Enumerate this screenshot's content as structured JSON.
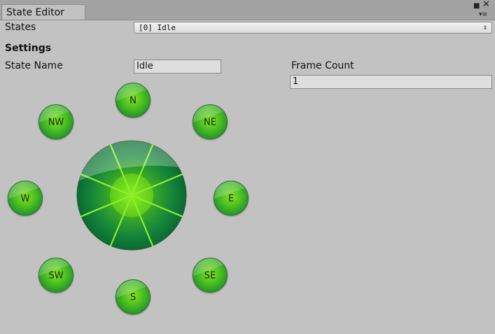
{
  "window": {
    "tab_title": "State Editor",
    "maximize_icon": "maximize-icon",
    "close_icon": "close-icon",
    "menu_icon": "menu-icon"
  },
  "states": {
    "label": "States",
    "selected": "[0] Idle"
  },
  "settings": {
    "heading": "Settings",
    "state_name_label": "State Name",
    "state_name_value": "Idle",
    "frame_count_label": "Frame Count",
    "frame_count_value": "1"
  },
  "directions": {
    "n": "N",
    "ne": "NE",
    "e": "E",
    "se": "SE",
    "s": "S",
    "sw": "SW",
    "w": "W",
    "nw": "NW"
  },
  "colors": {
    "button_green": "#4cc021",
    "button_dark": "#166b24",
    "ray_green": "#8cf02a"
  }
}
